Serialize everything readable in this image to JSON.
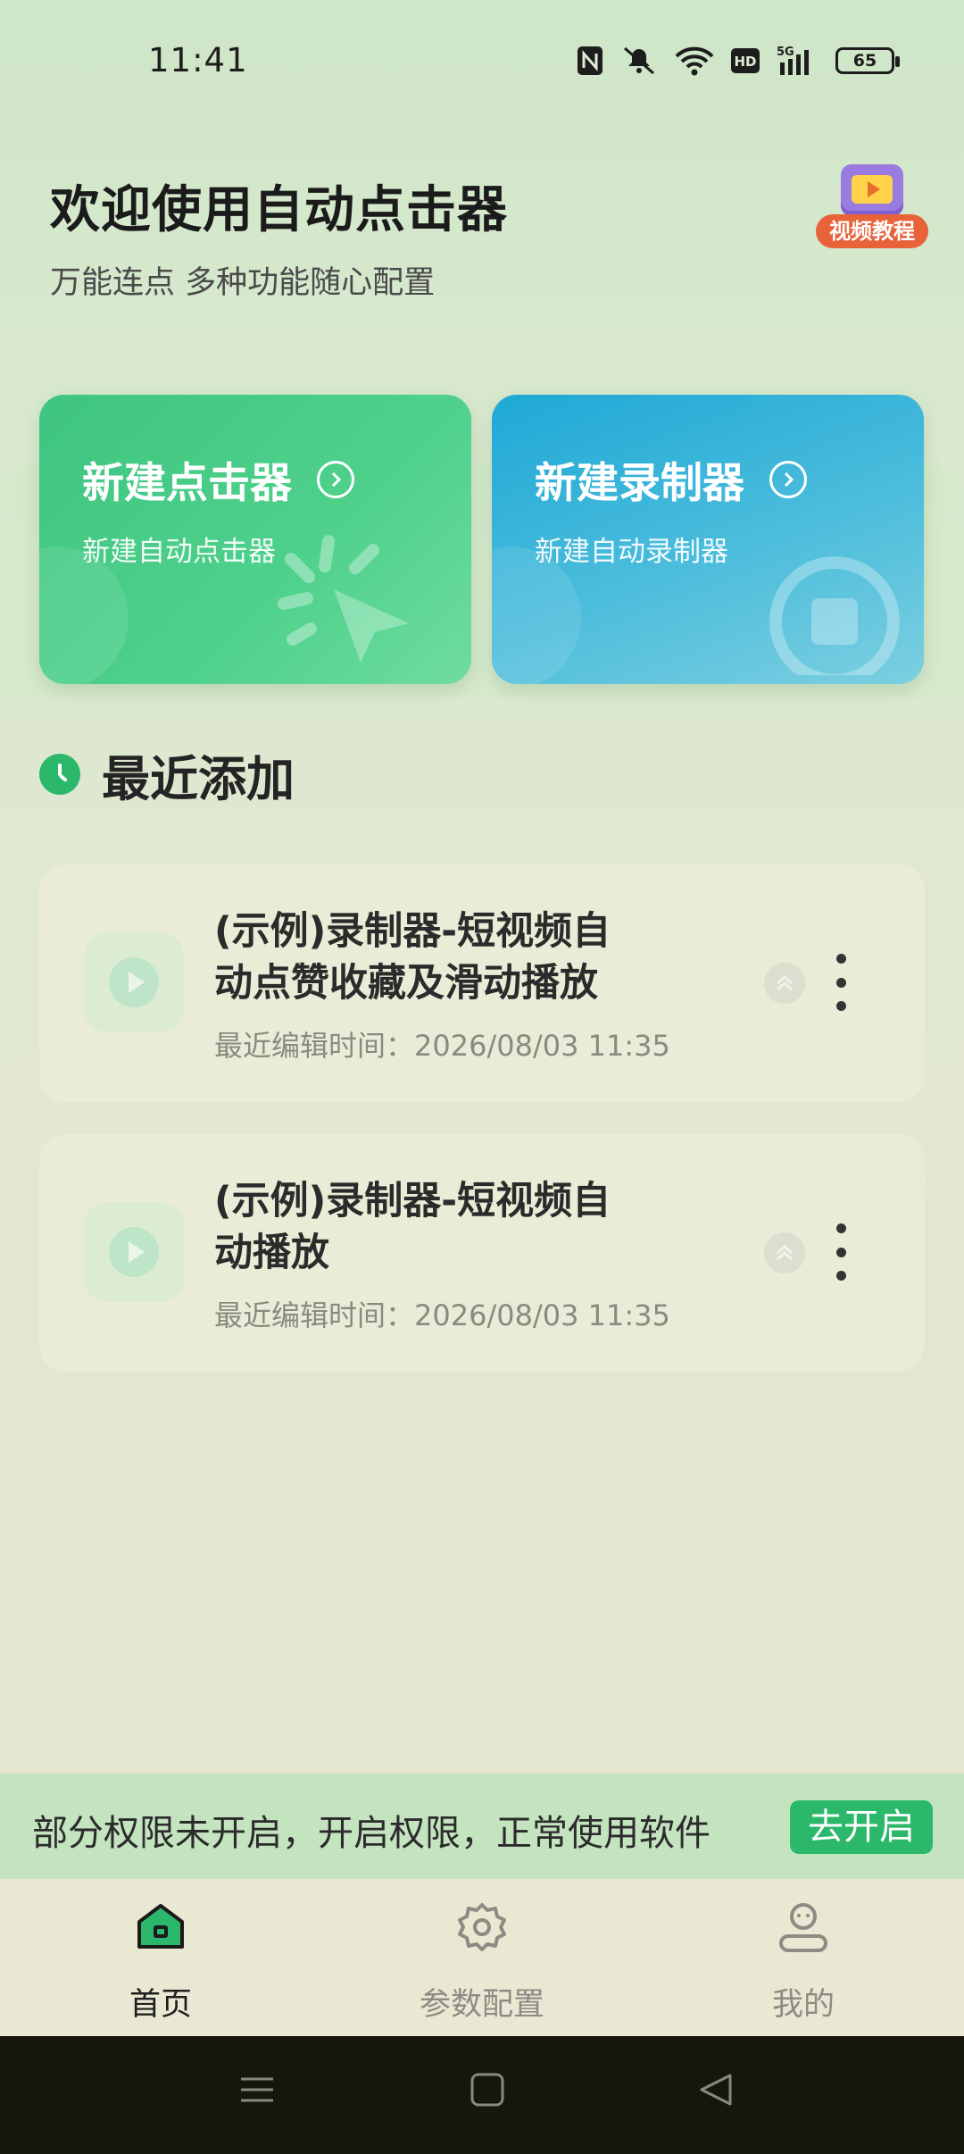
{
  "status_bar": {
    "time": "11:41",
    "battery": "65",
    "icons": [
      "nfc-icon",
      "mute-icon",
      "wifi-icon",
      "hd-icon",
      "signal-5g-icon",
      "battery-icon"
    ],
    "network": "5G",
    "hd": "HD"
  },
  "header": {
    "title": "欢迎使用自动点击器",
    "subtitle": "万能连点 多种功能随心配置",
    "tutorial_label": "视频教程"
  },
  "cards": {
    "clicker": {
      "title": "新建点击器",
      "desc": "新建自动点击器",
      "color": "#3ec57f"
    },
    "recorder": {
      "title": "新建录制器",
      "desc": "新建自动录制器",
      "color": "#1fa8d6"
    }
  },
  "recent": {
    "title": "最近添加",
    "items": [
      {
        "title": "(示例)录制器-短视频自动点赞收藏及滑动播放",
        "time": "最近编辑时间：2026/08/03 11:35"
      },
      {
        "title": "(示例)录制器-短视频自动播放",
        "time": "最近编辑时间：2026/08/03 11:35"
      }
    ]
  },
  "permission": {
    "text": "部分权限未开启，开启权限，正常使用软件",
    "button": "去开启"
  },
  "nav": {
    "items": [
      {
        "label": "首页",
        "icon": "home-icon",
        "active": true
      },
      {
        "label": "参数配置",
        "icon": "gear-icon",
        "active": false
      },
      {
        "label": "我的",
        "icon": "profile-icon",
        "active": false
      }
    ]
  },
  "theme": {
    "accent": "#2bb86a",
    "background": "#e2e8d2"
  }
}
